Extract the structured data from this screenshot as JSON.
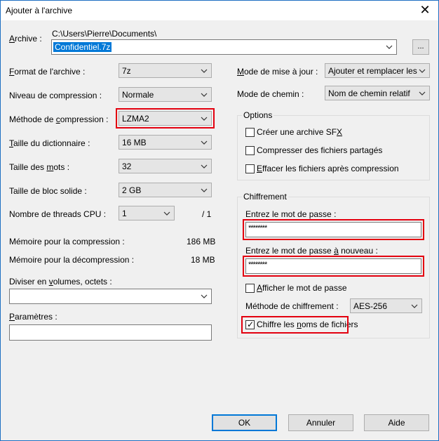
{
  "window": {
    "title": "Ajouter à l'archive"
  },
  "archive": {
    "label": "Archive :",
    "path": "C:\\Users\\Pierre\\Documents\\",
    "name": "Confidentiel.7z",
    "browse": "..."
  },
  "left": {
    "format_label": "Format de l'archive :",
    "format_value": "7z",
    "level_label": "Niveau de compression :",
    "level_value": "Normale",
    "method_label": "Méthode de compression :",
    "method_value": "LZMA2",
    "dict_label": "Taille du dictionnaire :",
    "dict_value": "16 MB",
    "word_label": "Taille des mots :",
    "word_value": "32",
    "block_label": "Taille de bloc solide :",
    "block_value": "2 GB",
    "threads_label": "Nombre de threads CPU :",
    "threads_value": "1",
    "threads_total": "/ 1",
    "mem_comp_label": "Mémoire pour la compression :",
    "mem_comp_value": "186 MB",
    "mem_decomp_label": "Mémoire pour la décompression :",
    "mem_decomp_value": "18 MB",
    "split_label": "Diviser en volumes, octets :",
    "split_value": "",
    "params_label": "Paramètres :",
    "params_value": ""
  },
  "right": {
    "update_label": "Mode de mise à jour :",
    "update_value": "Ajouter et remplacer les fich",
    "path_label": "Mode de chemin :",
    "path_value": "Nom de chemin relatif",
    "options": {
      "title": "Options",
      "sfx": "Créer une archive SFX",
      "shared": "Compresser des fichiers partagés",
      "delete": "Effacer les fichiers après compression"
    },
    "encryption": {
      "title": "Chiffrement",
      "pw_label": "Entrez le mot de passe :",
      "pw_value": "********",
      "pw2_label": "Entrez le mot de passe à nouveau :",
      "pw2_value": "********",
      "show_pw": "Afficher le mot de passe",
      "method_label": "Méthode de chiffrement :",
      "method_value": "AES-256",
      "encrypt_names": "Chiffre les noms de fichiers"
    }
  },
  "buttons": {
    "ok": "OK",
    "cancel": "Annuler",
    "help": "Aide"
  },
  "colors": {
    "highlight": "#e3000f",
    "accent": "#0078d7"
  }
}
